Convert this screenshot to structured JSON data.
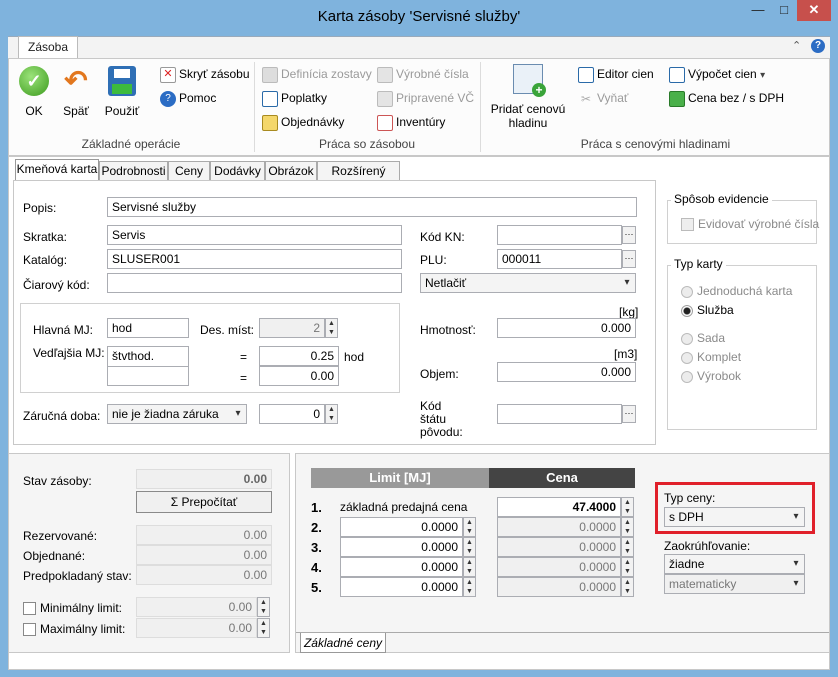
{
  "window": {
    "title": "Karta zásoby 'Servisné služby'",
    "min": "—",
    "max": "□",
    "close": "✕"
  },
  "ribbon": {
    "tab": "Zásoba",
    "help": "?",
    "min_glyph": "⌃",
    "groups": {
      "basic": {
        "label": "Základné operácie",
        "ok": "OK",
        "back": "Späť",
        "apply": "Použiť",
        "hide": "Skryť zásobu",
        "help": "Pomoc"
      },
      "work": {
        "label": "Práca so zásobou",
        "definition": "Definícia zostavy",
        "fees": "Poplatky",
        "orders": "Objednávky",
        "serials": "Výrobné čísla",
        "prepared": "Pripravené VČ",
        "inventory": "Inventúry"
      },
      "prices": {
        "label": "Práca s cenovými hladinami",
        "add_price_1": "Pridať cenovú",
        "add_price_2": "hladinu",
        "editor": "Editor cien",
        "cut": "Vyňať",
        "calc": "Výpočet cien",
        "calc_arrow": "▾",
        "cena": "Cena bez / s DPH"
      }
    }
  },
  "tabs": [
    "Kmeňová karta",
    "Podrobnosti",
    "Ceny",
    "Dodávky",
    "Obrázok",
    "Rozšírený popis"
  ],
  "form": {
    "popis_label": "Popis:",
    "popis": "Servisné služby",
    "skratka_label": "Skratka:",
    "skratka": "Servis",
    "katalog_label": "Katalóg:",
    "katalog": "SLUSER001",
    "ciarovy_label": "Čiarový kód:",
    "ciarovy": "",
    "kodkn_label": "Kód KN:",
    "kodkn": "",
    "plu_label": "PLU:",
    "plu": "000011",
    "print": "Netlačiť",
    "hlavna_label": "Hlavná MJ:",
    "hlavna": "hod",
    "des_label": "Des. míst:",
    "des": "2",
    "vedl_label": "Vedľajšia MJ:",
    "vedl": "štvthod.",
    "vedl2": "",
    "eq": "=",
    "ratio1": "0.25",
    "ratio_unit": "hod",
    "ratio2": "0.00",
    "kg": "[kg]",
    "hmot_label": "Hmotnosť:",
    "hmot": "0.000",
    "m3": "[m3]",
    "objem_label": "Objem:",
    "objem": "0.000",
    "zaruka_label": "Záručná doba:",
    "zaruka": "nie je žiadna záruka",
    "zaruka_num": "0",
    "kod_statu_1": "Kód",
    "kod_statu_2": "štátu",
    "kod_statu_3": "pôvodu:",
    "kod_statu": "",
    "dots": "···",
    "spin_up": "▲",
    "spin_down": "▼",
    "combo": "▾"
  },
  "evidence": {
    "title": "Spôsob evidencie",
    "serial": "Evidovať výrobné čísla"
  },
  "card_type": {
    "title": "Typ karty",
    "options": [
      "Jednoduchá karta",
      "Služba",
      "Sada",
      "Komplet",
      "Výrobok"
    ],
    "selected": "Služba"
  },
  "stock": {
    "stav_label": "Stav zásoby:",
    "stav": "0.00",
    "recalc": "Σ Prepočítať",
    "rezerv_label": "Rezervované:",
    "rezerv": "0.00",
    "objed_label": "Objednané:",
    "objed": "0.00",
    "predp_label": "Predpokladaný stav:",
    "predp": "0.00",
    "min_label": "Minimálny limit:",
    "min": "0.00",
    "max_label": "Maximálny limit:",
    "max": "0.00"
  },
  "prices_table": {
    "hdr_limit": "Limit [MJ]",
    "hdr_cena": "Cena",
    "rows": [
      {
        "num": "1.",
        "limit": "základná predajná cena",
        "cena": "47.4000"
      },
      {
        "num": "2.",
        "limit": "0.0000",
        "cena": "0.0000"
      },
      {
        "num": "3.",
        "limit": "0.0000",
        "cena": "0.0000"
      },
      {
        "num": "4.",
        "limit": "0.0000",
        "cena": "0.0000"
      },
      {
        "num": "5.",
        "limit": "0.0000",
        "cena": "0.0000"
      }
    ],
    "typ_label": "Typ ceny:",
    "typ": "s DPH",
    "zaok_label": "Zaokrúhľovanie:",
    "zaok": "žiadne",
    "zaok2": "matematicky",
    "bottom_tab": "Základné ceny"
  }
}
